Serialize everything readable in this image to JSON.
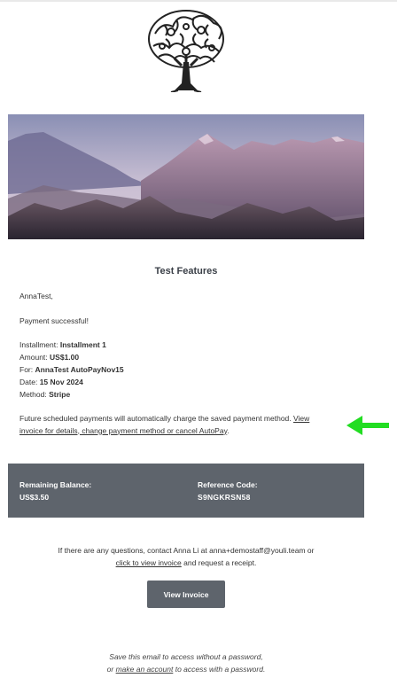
{
  "header": {
    "logo_icon": "tree-icon"
  },
  "hero": {
    "image": "mountain-landscape"
  },
  "title": "Test Features",
  "greeting": "AnnaTest,",
  "status": "Payment successful!",
  "details": {
    "installment_label": "Installment:",
    "installment_value": "Installment 1",
    "amount_label": "Amount:",
    "amount_value": "US$1.00",
    "for_label": "For:",
    "for_value": "AnnaTest AutoPayNov15",
    "date_label": "Date:",
    "date_value": "15 Nov 2024",
    "method_label": "Method:",
    "method_value": "Stripe"
  },
  "future": {
    "text": "Future scheduled payments will automatically charge the saved payment method.",
    "link": "View invoice for details, change payment method or cancel AutoPay",
    "end": "."
  },
  "annotation": {
    "icon": "arrow-left-icon",
    "color": "#22dd22"
  },
  "balance": {
    "remaining_label": "Remaining Balance:",
    "remaining_value": "US$3.50",
    "reference_label": "Reference Code:",
    "reference_value": "S9NGKRSN58"
  },
  "contact": {
    "text1": "If there are any questions, contact Anna Li at anna+demostaff@youli.team or",
    "link": "click to view invoice",
    "text2": "and request a receipt."
  },
  "button": {
    "label": "View Invoice"
  },
  "footer": {
    "line1_a": "Save this email to access",
    "line1_b": "without",
    "line1_c": "a password,",
    "line2_a": "or",
    "line2_link": "make an account",
    "line2_b": "to access",
    "line2_c": "with",
    "line2_d": "a password."
  },
  "colors": {
    "box": "#5e646c",
    "text": "#333333"
  }
}
